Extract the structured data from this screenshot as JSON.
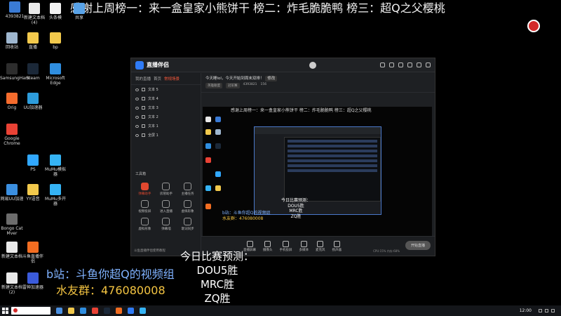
{
  "banner": {
    "text": "感谢上周榜一：来一盒皇家小熊饼干 榜二：炸毛脆脆鸭 榜三：超Q之父樱桃"
  },
  "desktop_icons": [
    {
      "label": "4393821",
      "color": "#3a7bd5"
    },
    {
      "label": "新建文本档(4)",
      "color": "#e9e9e9"
    },
    {
      "label": "头条模",
      "color": "#f2f2f2"
    },
    {
      "label": "共享",
      "color": "#59a3e8"
    },
    {
      "label": "回收站",
      "color": "#9fb7cf"
    },
    {
      "label": "直播",
      "color": "#f2c94c"
    },
    {
      "label": "bp",
      "color": "#f2c94c"
    },
    {
      "label": "SamsungHam",
      "color": "#2d2d2d"
    },
    {
      "label": "Steam",
      "color": "#1b2838"
    },
    {
      "label": "Microsoft Edge",
      "color": "#2f8ee0"
    },
    {
      "label": "Orig",
      "color": "#f56c2d"
    },
    {
      "label": "UU加速器",
      "color": "#2d9cdb"
    },
    {
      "label": "Google Chrome",
      "color": "#e94235"
    },
    {
      "label": "PS",
      "color": "#31a8ff"
    },
    {
      "label": "MuMu模拟器",
      "color": "#35b3f4"
    },
    {
      "label": "网易UU加速",
      "color": "#3b8fe0"
    },
    {
      "label": "YY语音",
      "color": "#f2c94c"
    },
    {
      "label": "MuMu多开器",
      "color": "#35b3f4"
    },
    {
      "label": "Bongo Cat Mver",
      "color": "#6c6c6c"
    },
    {
      "label": "新建文本档",
      "color": "#e9e9e9"
    },
    {
      "label": "斗鱼直播伴侣",
      "color": "#f26d21"
    },
    {
      "label": "新建文本档(2)",
      "color": "#e9e9e9"
    },
    {
      "label": "雷神加速器",
      "color": "#3b5bdb"
    }
  ],
  "app": {
    "title": "直播伴侣",
    "sidebar": {
      "tabs": [
        "我的直播",
        "首页",
        "常规场景"
      ],
      "active_tab": "常规场景",
      "scenes": [
        "文本 5",
        "文本 4",
        "文本 3",
        "文本 2",
        "文本 1",
        "全屏 1"
      ],
      "tools_label": "工具箱",
      "tools": [
        {
          "label": "弹幕助手",
          "active": true
        },
        {
          "label": "房管助手",
          "active": false
        },
        {
          "label": "主播任务",
          "active": false
        },
        {
          "label": "视频投屏",
          "active": false
        },
        {
          "label": "进入直播",
          "active": false
        },
        {
          "label": "虚拟形象",
          "active": false
        },
        {
          "label": "虚拟形象",
          "active": false
        },
        {
          "label": "弹幕墙",
          "active": false
        },
        {
          "label": "歌词同步",
          "active": false
        }
      ],
      "bottom_text": "斗鱼直播伴侣使用教程"
    },
    "room": {
      "title": "今天睡lol，今天开始到周末双排！",
      "edit": "修改",
      "tag1": "英雄联盟",
      "tag2": "冠军赛",
      "room_id": "4393821",
      "viewers": "156"
    },
    "preview": {
      "mini_banner": "感谢上周榜一：来一盒皇家小熊饼干 榜二：炸毛脆脆鸭 榜三：超Q之父樱桃",
      "mini_bili": "b站：斗鱼你超Q的视频组",
      "mini_qq": "水友群：476080008",
      "mini_predict": [
        "今日比赛预测：",
        "DOU5胜",
        "MRC胜",
        "ZQ胜"
      ]
    },
    "bottom_buttons": [
      "直播屏幕",
      "摄像头",
      "手机投屏",
      "多媒体",
      "麦克风",
      "扬声器"
    ],
    "stats": "CPU:15%  内存:68%",
    "start_live": "开始直播"
  },
  "overlay": {
    "predict_title": "今日比赛预测：",
    "predict_lines": [
      "DOU5胜",
      "MRC胜",
      "ZQ胜"
    ],
    "bili": "b站：斗鱼你超Q的视频组",
    "qq": "水友群：476080008"
  },
  "taskbar": {
    "clock": "12:00"
  }
}
